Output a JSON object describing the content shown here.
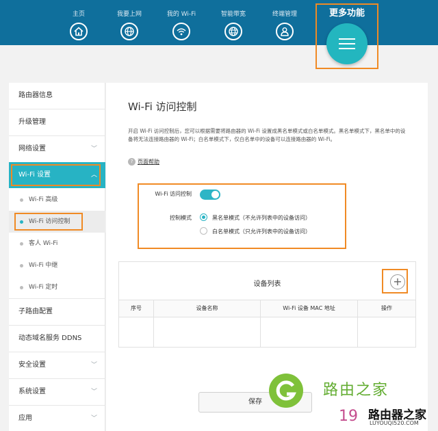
{
  "nav": {
    "items": [
      {
        "label": "主页",
        "icon": "home-icon"
      },
      {
        "label": "我要上网",
        "icon": "globe-icon"
      },
      {
        "label": "我的 Wi-Fi",
        "icon": "wifi-icon"
      },
      {
        "label": "智能带宽",
        "icon": "bandwidth-globe-icon"
      },
      {
        "label": "终端管理",
        "icon": "user-icon"
      }
    ],
    "more_label": "更多功能"
  },
  "sidebar": {
    "items": [
      {
        "label": "路由器信息"
      },
      {
        "label": "升级管理"
      },
      {
        "label": "网络设置",
        "chevron": "﹀"
      },
      {
        "label": "Wi-Fi 设置",
        "chevron": "︿"
      }
    ],
    "subitems": [
      {
        "label": "Wi-Fi 高级"
      },
      {
        "label": "Wi-Fi 访问控制"
      },
      {
        "label": "客人 Wi-Fi"
      },
      {
        "label": "Wi-Fi 中继"
      },
      {
        "label": "Wi-Fi 定时"
      }
    ],
    "items_after": [
      {
        "label": "子路由配置"
      },
      {
        "label": "动态域名服务 DDNS"
      },
      {
        "label": "安全设置",
        "chevron": "﹀"
      },
      {
        "label": "系统设置",
        "chevron": "﹀"
      },
      {
        "label": "应用",
        "chevron": "﹀"
      }
    ]
  },
  "main": {
    "title": "Wi-Fi 访问控制",
    "description": "开启 Wi-Fi 访问控制后，您可以根据需要将路由器的 Wi-Fi 设置成黑名单模式或白名单模式。黑名单模式下，黑名单中的设备将无法连接路由器的 Wi-Fi；白名单模式下，仅白名单中的设备可以连接路由器的 Wi-Fi。",
    "help_label": "页面帮助",
    "toggle_label": "Wi-Fi 访问控制",
    "toggle_on": true,
    "mode_label": "控制模式",
    "mode_options": [
      {
        "label": "黑名单模式（不允许列表中的设备访问）",
        "selected": true
      },
      {
        "label": "白名单模式（只允许列表中的设备访问）",
        "selected": false
      }
    ],
    "device_list": {
      "title": "设备列表",
      "add_symbol": "+",
      "columns": [
        "序号",
        "设备名称",
        "Wi-Fi 设备 MAC 地址",
        "操作"
      ],
      "rows": []
    },
    "save_label": "保存"
  },
  "watermark": {
    "brand": "路由之家",
    "number": "19",
    "site": "路由器之家",
    "url": "LUYOUQI520.COM"
  },
  "colors": {
    "topbar": "#0f6f9c",
    "accent": "#27b3c4",
    "highlight": "#f08a24"
  }
}
